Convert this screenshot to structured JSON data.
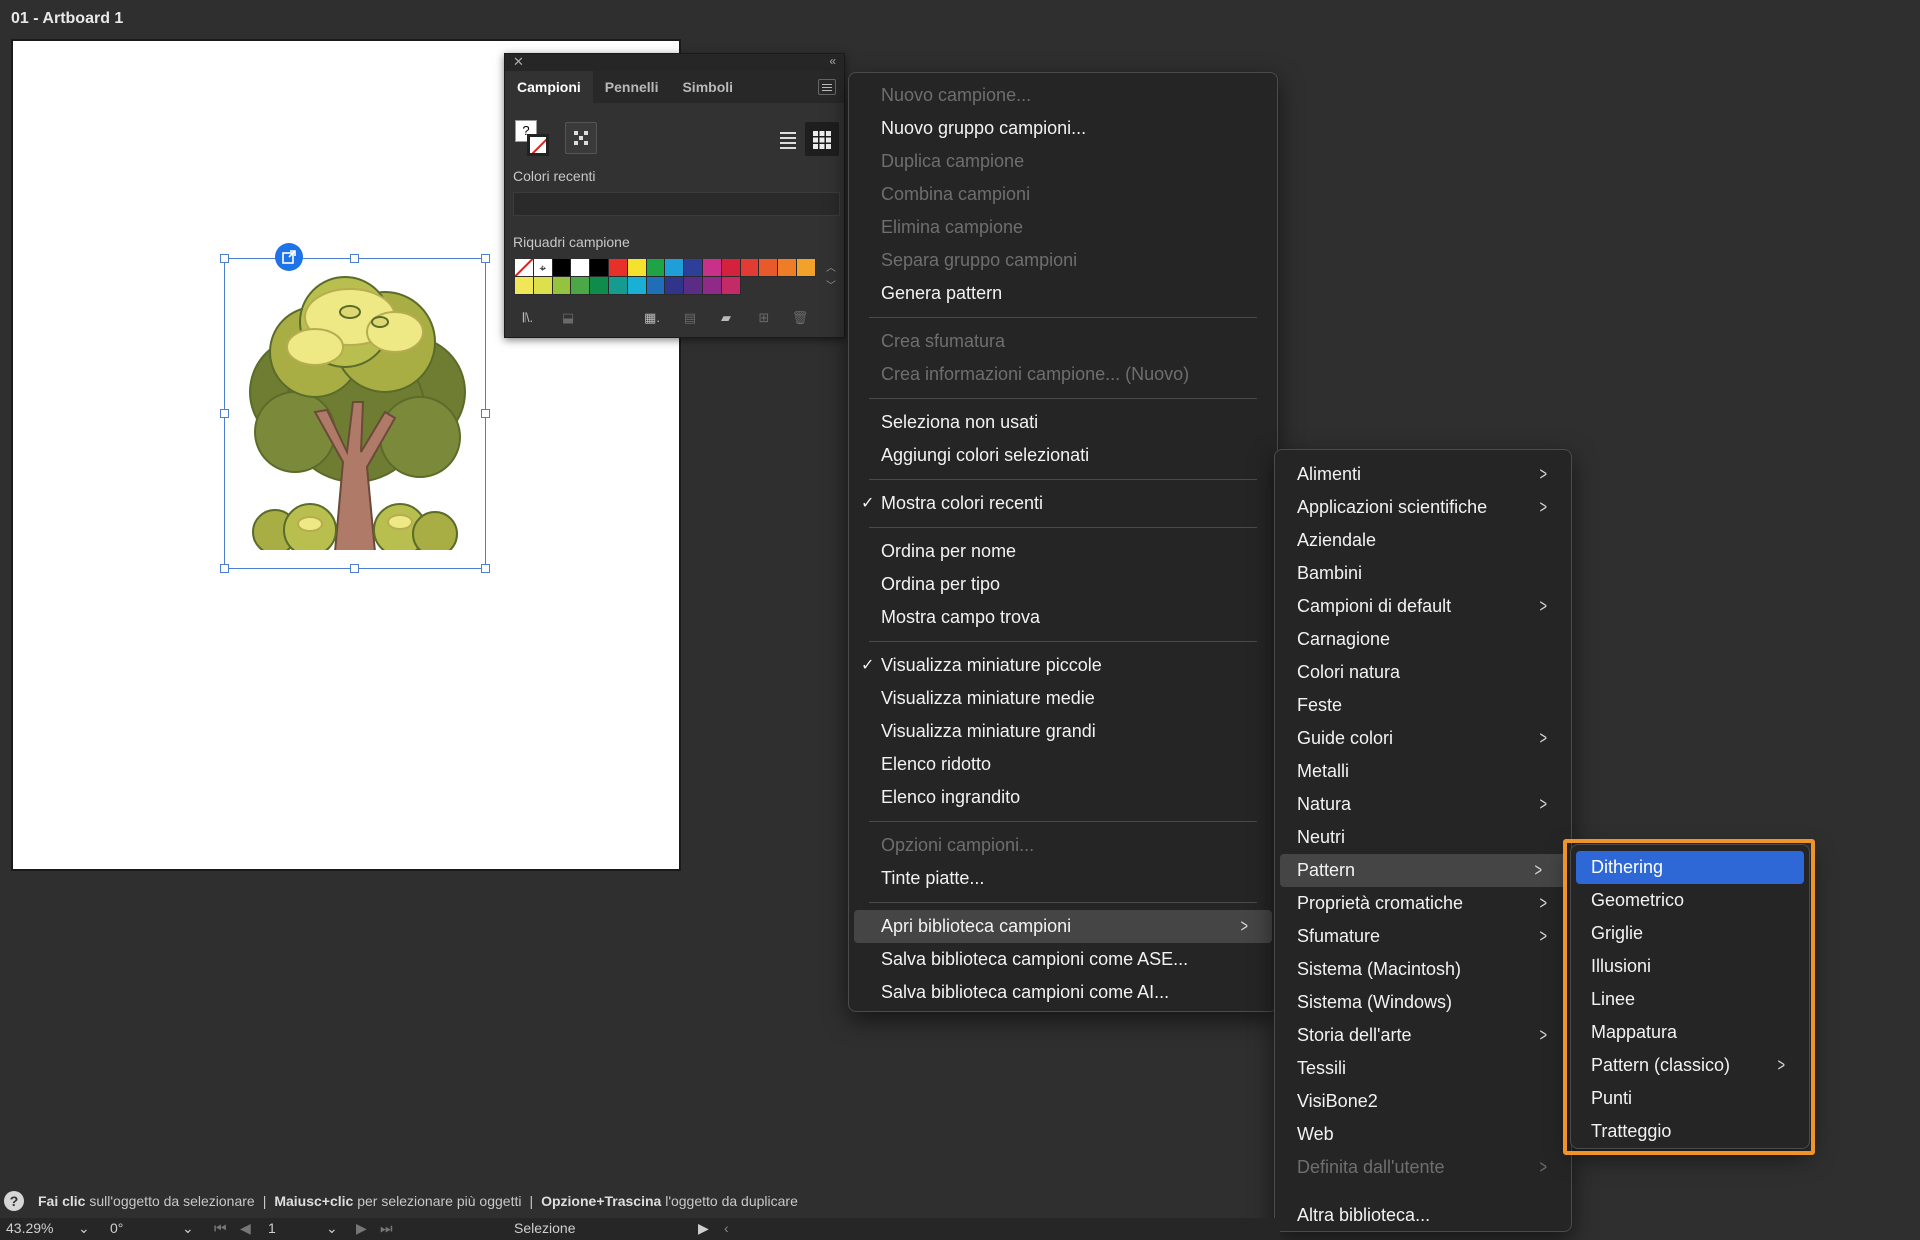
{
  "artboard": {
    "title": "01 - Artboard 1"
  },
  "swatch_panel": {
    "tabs": [
      "Campioni",
      "Pennelli",
      "Simboli"
    ],
    "fill_label": "?",
    "recent_colors_label": "Colori recenti",
    "swatches_label": "Riquadri campione",
    "swatch_colors": [
      "#ffffff",
      "#ffffff",
      "#000000",
      "#ffffff",
      "#000000",
      "#e8302a",
      "#f4e22c",
      "#1fa347",
      "#1e9fd8",
      "#2d3f98",
      "#c9308a",
      "#d4213d",
      "#e23b34",
      "#e85a2c",
      "#ed7d27",
      "#f2a12a",
      "#f1e55a",
      "#dbe04c",
      "#96c33f",
      "#4ca846",
      "#0f8b4b",
      "#169b8f",
      "#1ab0d6",
      "#1e6fb7",
      "#30358a",
      "#5a2c86",
      "#8f2a88",
      "#c42a65"
    ]
  },
  "main_menu": {
    "items": [
      {
        "label": "Nuovo campione...",
        "disabled": true
      },
      {
        "label": "Nuovo gruppo campioni...",
        "disabled": false
      },
      {
        "label": "Duplica campione",
        "disabled": true
      },
      {
        "label": "Combina campioni",
        "disabled": true
      },
      {
        "label": "Elimina campione",
        "disabled": true
      },
      {
        "label": "Separa gruppo campioni",
        "disabled": true
      },
      {
        "label": "Genera pattern",
        "disabled": false
      },
      {
        "label": "Crea sfumatura",
        "disabled": true
      },
      {
        "label": "Crea informazioni campione... (Nuovo)",
        "disabled": true
      },
      {
        "label": "Seleziona non usati",
        "disabled": false
      },
      {
        "label": "Aggiungi colori selezionati",
        "disabled": false
      },
      {
        "label": "Mostra colori recenti",
        "disabled": false,
        "checked": true
      },
      {
        "label": "Ordina per nome",
        "disabled": false
      },
      {
        "label": "Ordina per tipo",
        "disabled": false
      },
      {
        "label": "Mostra campo trova",
        "disabled": false
      },
      {
        "label": "Visualizza miniature piccole",
        "disabled": false,
        "checked": true
      },
      {
        "label": "Visualizza miniature medie",
        "disabled": false
      },
      {
        "label": "Visualizza miniature grandi",
        "disabled": false
      },
      {
        "label": "Elenco ridotto",
        "disabled": false
      },
      {
        "label": "Elenco ingrandito",
        "disabled": false
      },
      {
        "label": "Opzioni campioni...",
        "disabled": true
      },
      {
        "label": "Tinte piatte...",
        "disabled": false
      },
      {
        "label": "Apri biblioteca campioni",
        "disabled": false,
        "submenu": true,
        "highlighted": true
      },
      {
        "label": "Salva biblioteca campioni come ASE...",
        "disabled": false
      },
      {
        "label": "Salva biblioteca campioni come AI...",
        "disabled": false
      }
    ]
  },
  "library_menu": {
    "items": [
      {
        "label": "Alimenti",
        "submenu": true
      },
      {
        "label": "Applicazioni scientifiche",
        "submenu": true
      },
      {
        "label": "Aziendale"
      },
      {
        "label": "Bambini"
      },
      {
        "label": "Campioni di default",
        "submenu": true
      },
      {
        "label": "Carnagione"
      },
      {
        "label": "Colori natura"
      },
      {
        "label": "Feste"
      },
      {
        "label": "Guide colori",
        "submenu": true
      },
      {
        "label": "Metalli"
      },
      {
        "label": "Natura",
        "submenu": true
      },
      {
        "label": "Neutri"
      },
      {
        "label": "Pattern",
        "submenu": true,
        "highlighted": true
      },
      {
        "label": "Proprietà cromatiche",
        "submenu": true
      },
      {
        "label": "Sfumature",
        "submenu": true
      },
      {
        "label": "Sistema (Macintosh)"
      },
      {
        "label": "Sistema (Windows)"
      },
      {
        "label": "Storia dell'arte",
        "submenu": true
      },
      {
        "label": "Tessili"
      },
      {
        "label": "VisiBone2"
      },
      {
        "label": "Web"
      },
      {
        "label": "Definita dall'utente",
        "submenu": true,
        "disabled": true
      },
      {
        "label": "Altra biblioteca..."
      }
    ]
  },
  "pattern_menu": {
    "items": [
      {
        "label": "Dithering",
        "selected": true
      },
      {
        "label": "Geometrico"
      },
      {
        "label": "Griglie"
      },
      {
        "label": "Illusioni"
      },
      {
        "label": "Linee"
      },
      {
        "label": "Mappatura"
      },
      {
        "label": "Pattern (classico)",
        "submenu": true
      },
      {
        "label": "Punti"
      },
      {
        "label": "Tratteggio"
      }
    ]
  },
  "status": {
    "help_icon": "?",
    "hint1_bold": "Fai clic",
    "hint1": " sull'oggetto da selezionare",
    "sep": "|",
    "hint2_bold": "Maiusc+clic",
    "hint2": " per selezionare più oggetti",
    "hint3_bold": "Opzione+Trascina",
    "hint3": " l'oggetto da duplicare",
    "zoom": "43.29%",
    "rotation": "0°",
    "artboard_number": "1",
    "tool": "Selezione"
  },
  "colors": {
    "accent": "#2d68d6",
    "highlight_frame": "#f0932b"
  }
}
